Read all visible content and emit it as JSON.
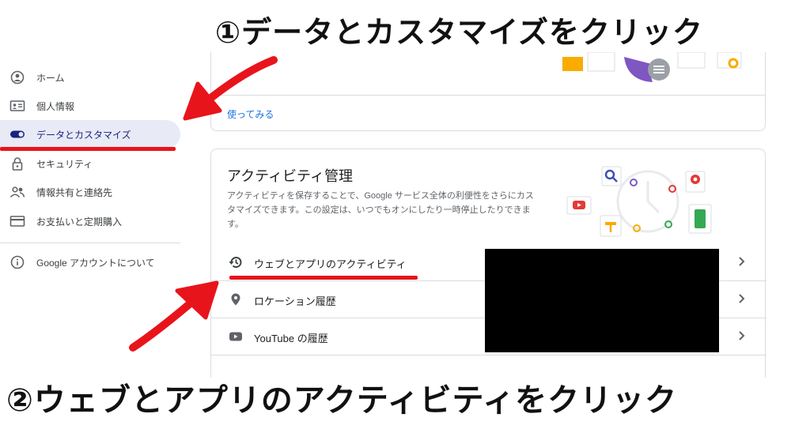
{
  "captions": {
    "step1": "①データとカスタマイズをクリック",
    "step2": "②ウェブとアプリのアクティビティをクリック"
  },
  "sidebar": {
    "items": [
      {
        "label": "ホーム",
        "icon": "home-icon"
      },
      {
        "label": "個人情報",
        "icon": "id-card-icon"
      },
      {
        "label": "データとカスタマイズ",
        "icon": "toggle-icon",
        "active": true
      },
      {
        "label": "セキュリティ",
        "icon": "lock-icon"
      },
      {
        "label": "情報共有と連絡先",
        "icon": "people-icon"
      },
      {
        "label": "お支払いと定期購入",
        "icon": "credit-card-icon"
      }
    ],
    "about": {
      "label": "Google アカウントについて",
      "icon": "info-icon"
    }
  },
  "top_card": {
    "link": "使ってみる"
  },
  "activity": {
    "title": "アクティビティ管理",
    "description": "アクティビティを保存することで、Google サービス全体の利便性をさらにカスタマイズできます。この設定は、いつでもオンにしたり一時停止したりできます。",
    "rows": [
      {
        "label": "ウェブとアプリのアクティビティ",
        "icon": "history-icon"
      },
      {
        "label": "ロケーション履歴",
        "icon": "location-pin-icon"
      },
      {
        "label": "YouTube の履歴",
        "icon": "youtube-icon"
      }
    ]
  },
  "colors": {
    "accent": "#1a73e8",
    "annotation_red": "#e8141b",
    "active_nav_bg": "#e8eaf6"
  }
}
